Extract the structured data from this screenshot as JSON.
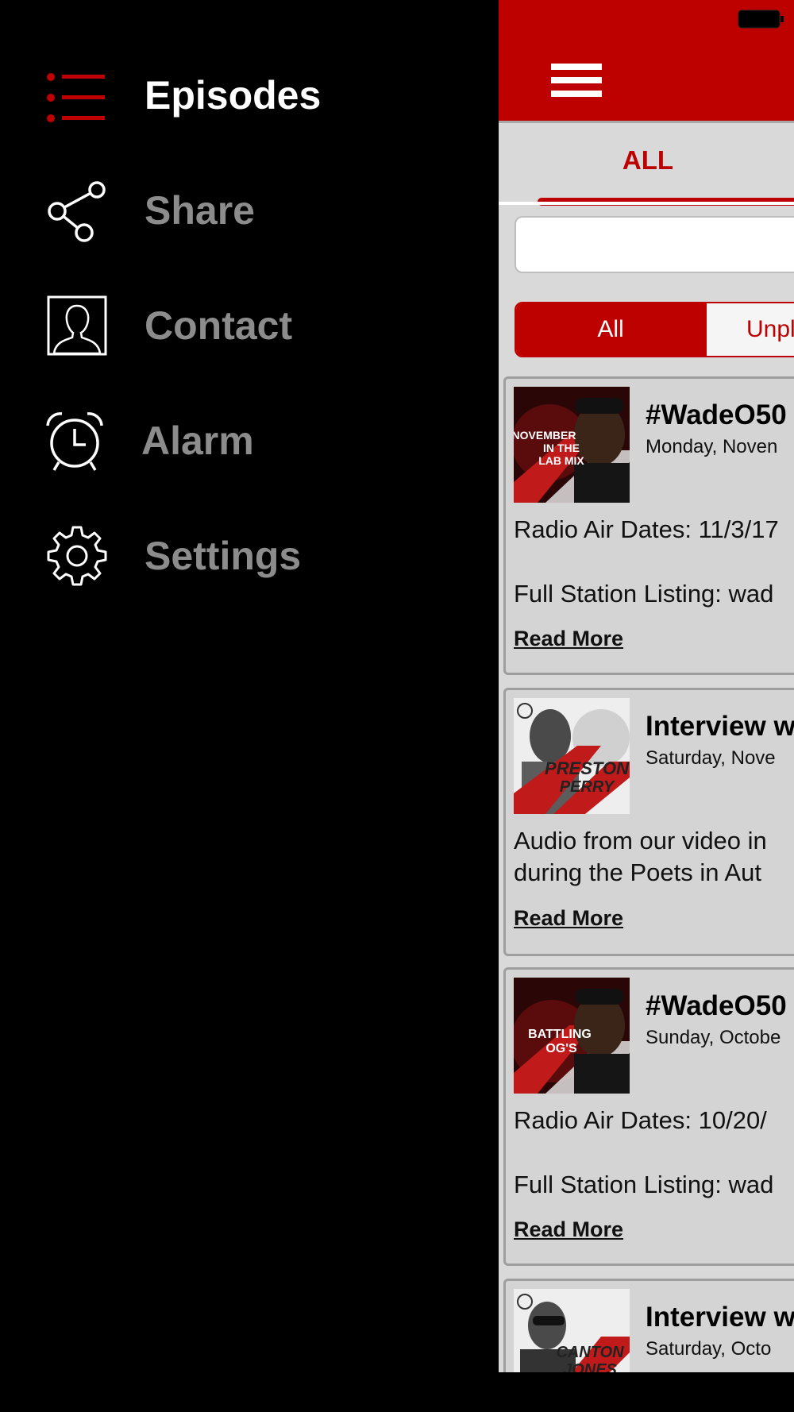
{
  "menu": {
    "items": [
      {
        "label": "Episodes",
        "icon": "list-icon",
        "active": true
      },
      {
        "label": "Share",
        "icon": "share-icon",
        "active": false
      },
      {
        "label": "Contact",
        "icon": "contact-icon",
        "active": false
      },
      {
        "label": "Alarm",
        "icon": "alarm-clock-icon",
        "active": false
      },
      {
        "label": "Settings",
        "icon": "gear-icon",
        "active": false
      }
    ]
  },
  "header": {
    "tab_label": "ALL"
  },
  "search": {
    "value": "",
    "placeholder": ""
  },
  "filter": {
    "all_label": "All",
    "unplayed_label": "Unpl"
  },
  "episodes": [
    {
      "title": "#WadeO50",
      "date": "Monday, Noven",
      "desc1": "Radio Air Dates: 11/3/17",
      "desc2": "Full Station Listing: wad",
      "read_more": "Read More",
      "thumb_text": "NOVEMBER IN THE LAB MIX"
    },
    {
      "title": "Interview w",
      "date": "Saturday, Nove",
      "desc1": "Audio from our video in",
      "desc2": "during the Poets in Aut",
      "read_more": "Read More",
      "thumb_text": "PRESTON PERRY"
    },
    {
      "title": "#WadeO50",
      "date": "Sunday, Octobe",
      "desc1": "Radio Air Dates: 10/20/",
      "desc2": "Full Station Listing: wad",
      "read_more": "Read More",
      "thumb_text": "BATTLING OG'S"
    },
    {
      "title": "Interview w",
      "date": "Saturday, Octo",
      "thumb_text": "CANTON JONES"
    }
  ],
  "colors": {
    "brand_red": "#bd0000",
    "panel_gray": "#d9d9d9",
    "menu_bg": "#000000"
  }
}
